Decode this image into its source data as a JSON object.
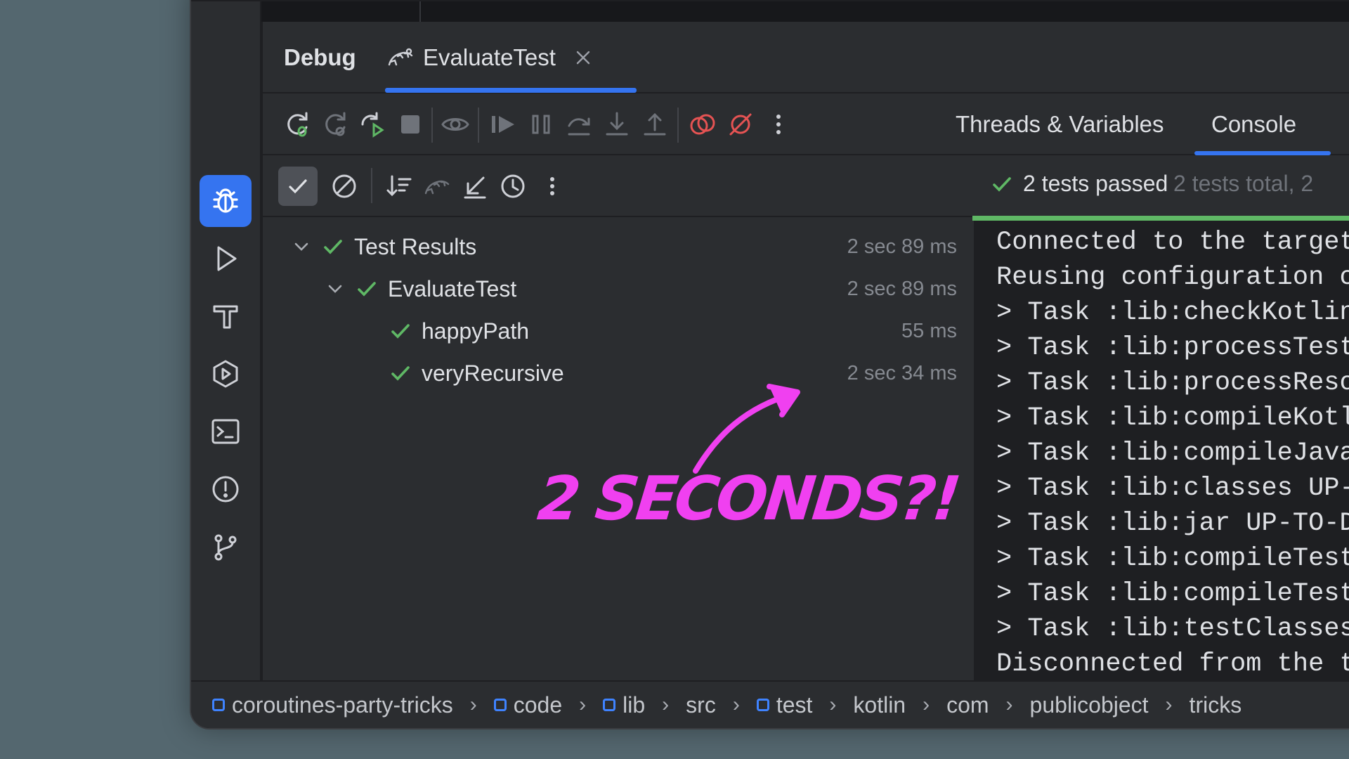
{
  "tabs": {
    "debug_label": "Debug",
    "active_tab_label": "EvaluateTest"
  },
  "toolbar": {
    "icons": [
      "rerun-icon",
      "rerun-failed-icon",
      "restart-icon",
      "stop-icon",
      "view-breakpoints-icon",
      "resume-icon",
      "pause-icon",
      "step-over-icon",
      "step-into-icon",
      "step-out-icon",
      "view-breakpoints-red-icon",
      "mute-breakpoints-icon",
      "more-icon"
    ],
    "right_tabs": [
      "Threads & Variables",
      "Console"
    ],
    "active_right_tab": "Console"
  },
  "test_toolbar": {
    "icons": [
      "show-passed-icon",
      "show-ignored-icon",
      "sort-icon",
      "collapse-icon",
      "import-tests-icon",
      "history-icon",
      "more-icon"
    ]
  },
  "status": {
    "passed": "2 tests passed",
    "total": "2 tests total, 2"
  },
  "tree": [
    {
      "label": "Test Results",
      "time": "2 sec 89 ms",
      "level": 0,
      "expanded": true
    },
    {
      "label": "EvaluateTest",
      "time": "2 sec 89 ms",
      "level": 1,
      "expanded": true
    },
    {
      "label": "happyPath",
      "time": "55 ms",
      "level": 2
    },
    {
      "label": "veryRecursive",
      "time": "2 sec 34 ms",
      "level": 2
    }
  ],
  "console": [
    "Connected to the target VM",
    "Reusing configuration cach",
    "> Task :lib:checkKotlinGra",
    "> Task :lib:processTestRes",
    "> Task :lib:processResourc",
    "> Task :lib:compileKotlin",
    "> Task :lib:compileJava NO",
    "> Task :lib:classes UP-TO-",
    "> Task :lib:jar UP-TO-DATE",
    "> Task :lib:compileTestKot",
    "> Task :lib:compileTestJav",
    "> Task :lib:testClasses UP",
    "Disconnected from the targ"
  ],
  "breadcrumbs": [
    {
      "label": "coroutines-party-tricks",
      "module": true
    },
    {
      "label": "code",
      "module": true
    },
    {
      "label": "lib",
      "module": true
    },
    {
      "label": "src",
      "module": false
    },
    {
      "label": "test",
      "module": true
    },
    {
      "label": "kotlin",
      "module": false
    },
    {
      "label": "com",
      "module": false
    },
    {
      "label": "publicobject",
      "module": false
    },
    {
      "label": "tricks",
      "module": false
    }
  ],
  "annotation": "2 SECONDS?!",
  "colors": {
    "accent": "#3574f0",
    "pass_green": "#5fb865",
    "annotation": "#f040f0",
    "stop_red": "#e55353"
  }
}
